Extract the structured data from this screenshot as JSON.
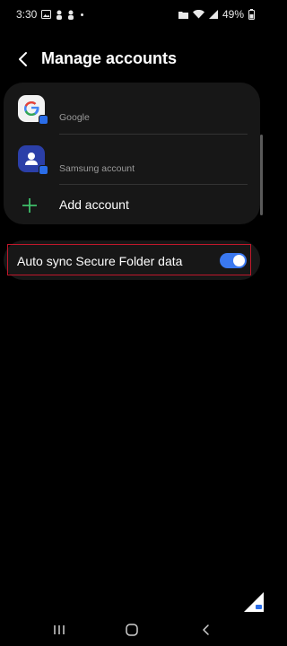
{
  "status_bar": {
    "time": "3:30",
    "battery": "49%"
  },
  "header": {
    "title": "Manage accounts"
  },
  "accounts": [
    {
      "label": "Google",
      "icon": "google-icon"
    },
    {
      "label": "Samsung account",
      "icon": "samsung-account-icon"
    }
  ],
  "add_account": {
    "label": "Add account"
  },
  "auto_sync": {
    "label": "Auto sync Secure Folder data",
    "enabled": true
  },
  "colors": {
    "accent": "#3a78f0",
    "add_plus": "#3fbf6a",
    "highlight": "#c0182b"
  }
}
